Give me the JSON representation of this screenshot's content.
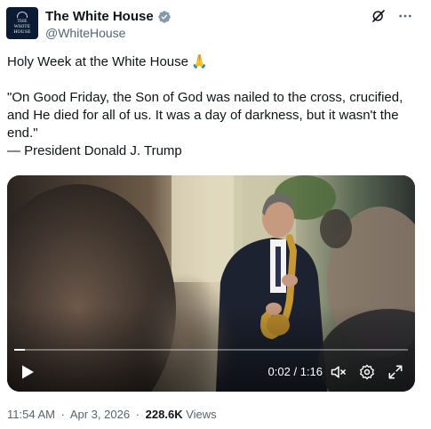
{
  "account": {
    "display_name": "The White House",
    "handle": "@WhiteHouse",
    "avatar_text_line1": "THE",
    "avatar_text_line2": "WHITE",
    "avatar_text_line3": "HOUSE",
    "verified_color": "#829aab"
  },
  "post": {
    "line1": "Holy Week at the White House",
    "line1_emoji": "🙏",
    "quote": "\"On Good Friday, the Son of God was nailed to the cross, crucified, and He died for all of us. It was a day of darkness, but it wasn't the end.\"",
    "attribution": "— President Donald J. Trump"
  },
  "video": {
    "current_time": "0:02",
    "separator": " / ",
    "duration": "1:16",
    "progress_fraction": 0.026,
    "icons": [
      "play-icon",
      "mute-icon",
      "settings-icon",
      "fullscreen-icon"
    ]
  },
  "meta": {
    "time": "11:54 AM",
    "dot1": "·",
    "date": "Apr 3, 2026",
    "dot2": "·",
    "views_count": "228.6K",
    "views_label": "Views"
  },
  "colors": {
    "text_primary": "#0f1419",
    "text_secondary": "#536471",
    "avatar_bg": "#0b1b33"
  }
}
